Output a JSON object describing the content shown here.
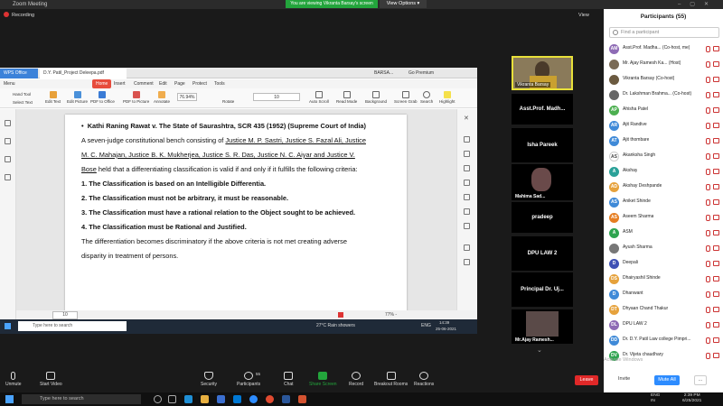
{
  "zoom": {
    "title": "Zoom Meeting",
    "viewing_banner": "You are viewing Vikranta Barsay's screen",
    "view_options": "View Options ▾",
    "recording": "Recording",
    "view": "View"
  },
  "wps": {
    "app_tab": "WPS Office",
    "file_tab": "D.Y. Patil_Project Deleepa.pdf",
    "user": "BARSA...",
    "go_premium": "Go Premium",
    "menu": [
      "Menu",
      "Home",
      "Insert",
      "Comment",
      "Edit",
      "Page",
      "Protect",
      "Tools"
    ],
    "tools": [
      "Hand Tool",
      "Select Text",
      "Edit Text",
      "Edit Picture",
      "PDF to Office",
      "PDF to Picture",
      "Annotate",
      "Rotate",
      "Auto Scroll",
      "Read Mode",
      "Background",
      "Screen Grab",
      "Search",
      "Highlight"
    ],
    "zoom_level": "76.94%",
    "page_field": "10",
    "status_page": "10",
    "status_zoom": "77% -"
  },
  "document": {
    "heading": "Kathi Raning Rawat v. The State of Saurashtra, SCR 435 (1952) (Supreme Court of India)",
    "para1_a": "A seven-judge constitutional bench consisting of ",
    "para1_b": "Justice M. P. Sastri, Justice S. Fazal Ali, Justice",
    "para1_line2": "M. C. Mahajan, Justice B. K. Mukherjea, Justice S. R. Das, Justice N. C. Aiyar and Justice V.",
    "para1_line3a": "Bose",
    "para1_line3b": " held that a differentiating classification is valid if and only if it fulfills the following criteria:",
    "criteria": [
      "1.  The Classification is based on an Intelligible Differentia.",
      "2.  The Classification must not be arbitrary, it must be reasonable.",
      "3.  The Classification must have a rational relation to the Object sought to be achieved.",
      "4.  The Classification must be Rational and Justified."
    ],
    "para2_line1": "The differentiation becomes discriminatory if the above criteria is not met creating adverse",
    "para2_line2": "disparity in treatment of persons."
  },
  "inner_taskbar": {
    "search": "Type here to search",
    "weather": "27°C  Rain showers",
    "lang": "ENG",
    "time": "14:39",
    "date": "25-06-2021"
  },
  "tiles": [
    {
      "name": "Vikranta Barsay"
    },
    {
      "name": "Asst.Prof. Madh..."
    },
    {
      "name": "Isha Pareek"
    },
    {
      "name": "Mahima Sad..."
    },
    {
      "name": "pradeep"
    },
    {
      "name": "DPU LAW 2"
    },
    {
      "name": "Principal  Dr. Uj..."
    },
    {
      "name": "Mr.Ajay Ramesh..."
    }
  ],
  "panel": {
    "title": "Participants (55)",
    "find": "Find a participant",
    "participants": [
      {
        "initials": "AM",
        "name": "Asst.Prof. Madha... (Co-host, me)",
        "color": "#8e6bb5"
      },
      {
        "initials": "",
        "name": "Mr. Ajay Ramesh Ka... (Host)",
        "color": "#7a6a55"
      },
      {
        "initials": "",
        "name": "Vikranta Barsay (Co-host)",
        "color": "#6b5a40"
      },
      {
        "initials": "",
        "name": "Dr. Lakshman Brahma... (Co-host)",
        "color": "#666666"
      },
      {
        "initials": "AP",
        "name": "Ahisha Patel",
        "color": "#4caf50"
      },
      {
        "initials": "AR",
        "name": "Ajit Randive",
        "color": "#3f8ad8"
      },
      {
        "initials": "AT",
        "name": "Ajit thombare",
        "color": "#3f8ad8"
      },
      {
        "initials": "AS",
        "name": "Akanksha Singh",
        "color": "#ffffff"
      },
      {
        "initials": "A",
        "name": "Akshay",
        "color": "#2aa198"
      },
      {
        "initials": "AD",
        "name": "Akshay Deshpande",
        "color": "#e6a23c"
      },
      {
        "initials": "AS",
        "name": "Aniket Shinde",
        "color": "#3f8ad8"
      },
      {
        "initials": "AS",
        "name": "Aseem Sharma",
        "color": "#e67e22"
      },
      {
        "initials": "A",
        "name": "ASM",
        "color": "#2ea44f"
      },
      {
        "initials": "",
        "name": "Ayush Sharma",
        "color": "#777777"
      },
      {
        "initials": "D",
        "name": "Deepali",
        "color": "#3f51b5"
      },
      {
        "initials": "DS",
        "name": "Dhairyashil Shinde",
        "color": "#e6a23c"
      },
      {
        "initials": "D",
        "name": "Dhanwant",
        "color": "#3f8ad8"
      },
      {
        "initials": "DT",
        "name": "Dhyaan Chand Thakur",
        "color": "#e6a23c"
      },
      {
        "initials": "DL",
        "name": "DPU LAW 2",
        "color": "#8e6bb5"
      },
      {
        "initials": "DD",
        "name": "Dr. D.Y. Patil Law college Pimpri...",
        "color": "#3f8ad8"
      },
      {
        "initials": "DV",
        "name": "Dr. Vijeta chaudhary",
        "color": "#2ea44f"
      }
    ],
    "invite": "Invite",
    "mute_all": "Mute All",
    "more": "..."
  },
  "activate_windows": "Activate Windows",
  "controls": {
    "unmute": "Unmute",
    "start_video": "Start Video",
    "security": "Security",
    "participants": "Participants",
    "participants_count": "55",
    "chat": "Chat",
    "share_screen": "Share Screen",
    "record": "Record",
    "breakout": "Breakout Rooms",
    "reactions": "Reactions",
    "leave": "Leave"
  },
  "taskbar": {
    "search": "Type here to search",
    "lang": "ENG",
    "region": "IN",
    "time": "2:39 PM",
    "date": "6/25/2021"
  },
  "colors": {
    "accent": "#2d8cff",
    "leave": "#e02828",
    "banner": "#23a53c",
    "speaker_border": "#e8e03a"
  }
}
